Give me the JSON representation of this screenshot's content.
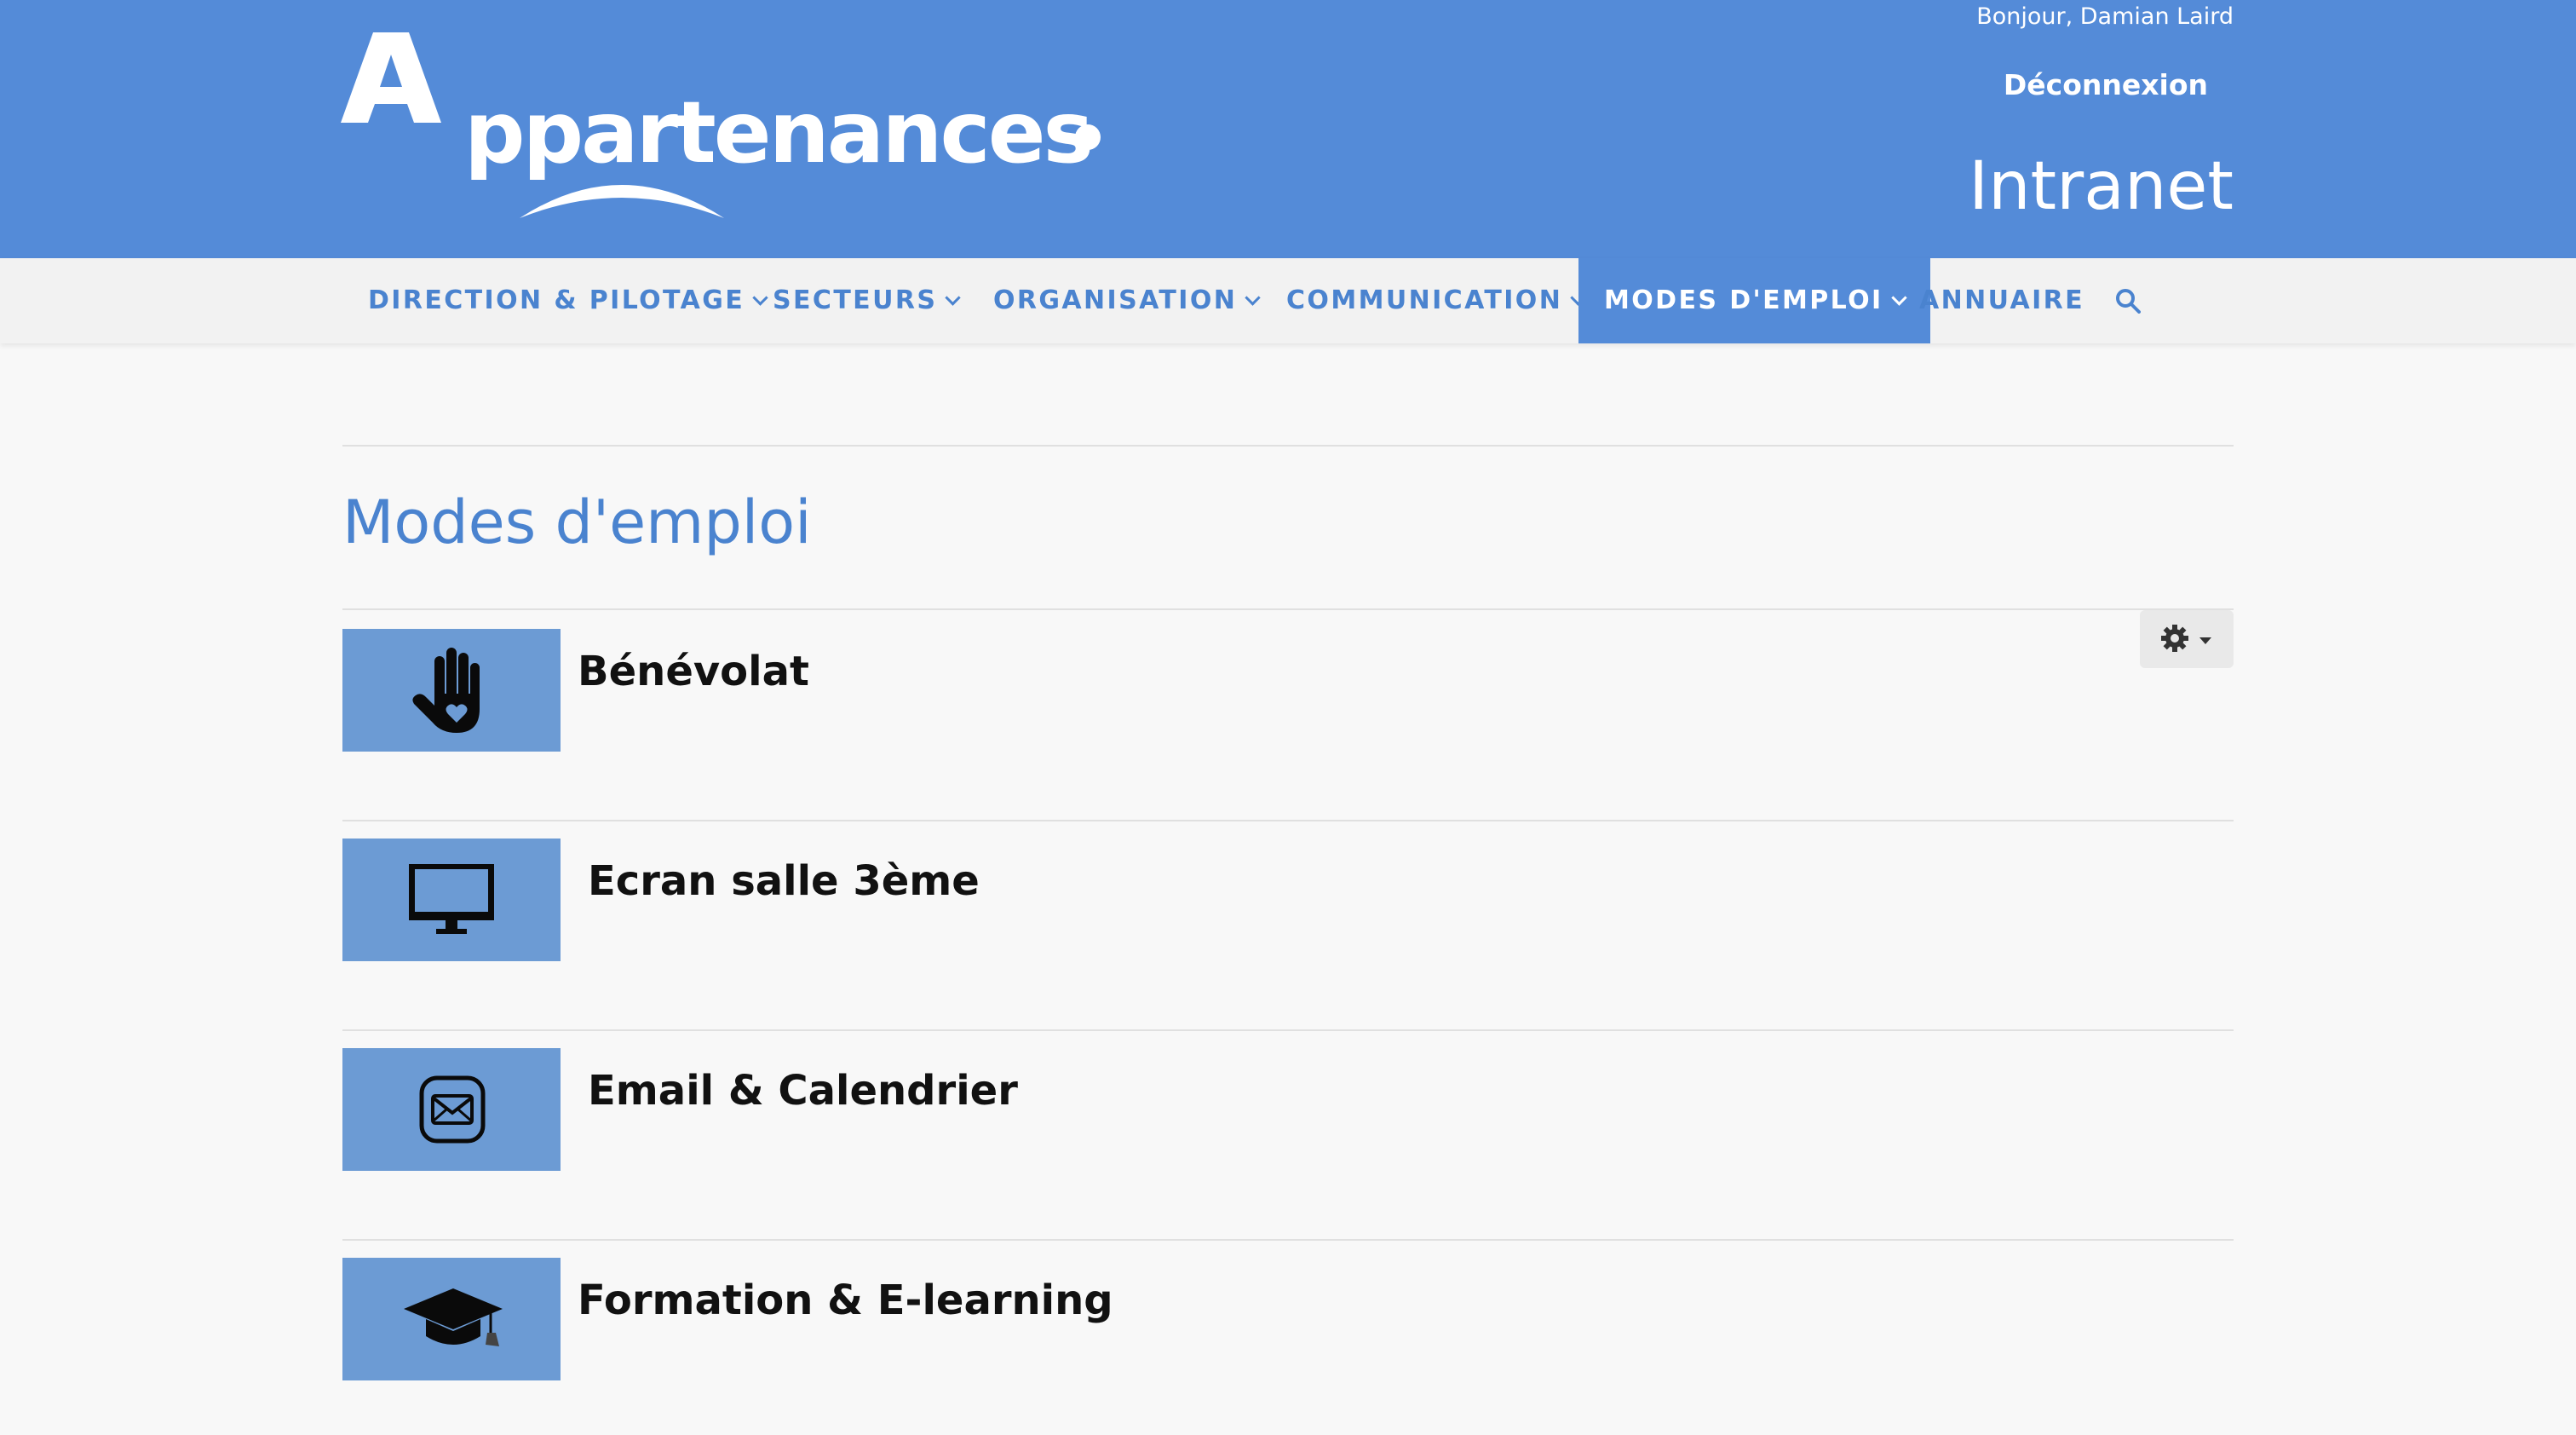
{
  "header": {
    "logo_initial": "A",
    "logo_text": "ppartenances",
    "greeting": "Bonjour, Damian Laird",
    "logout_label": "Déconnexion",
    "site_label": "Intranet",
    "background_color": "#548bd8"
  },
  "nav": {
    "items": [
      {
        "label": "DIRECTION & PILOTAGE",
        "dropdown": true
      },
      {
        "label": "SECTEURS",
        "dropdown": true
      },
      {
        "label": "ORGANISATION",
        "dropdown": true
      },
      {
        "label": "COMMUNICATION",
        "dropdown": true
      },
      {
        "label": "MODES D'EMPLOI",
        "dropdown": true,
        "active": true
      },
      {
        "label": "ANNUAIRE",
        "dropdown": false
      }
    ],
    "search_icon": "search-icon",
    "accent_color": "#4a83cf"
  },
  "main": {
    "title": "Modes d'emploi",
    "settings_icon": "gear-icon",
    "items": [
      {
        "title": "Bénévolat",
        "icon": "hand-heart-icon"
      },
      {
        "title": "Ecran salle 3ème",
        "icon": "monitor-icon"
      },
      {
        "title": "Email & Calendrier",
        "icon": "envelope-icon"
      },
      {
        "title": "Formation & E-learning",
        "icon": "graduation-cap-icon"
      }
    ],
    "thumb_color": "#6c9bd4"
  }
}
